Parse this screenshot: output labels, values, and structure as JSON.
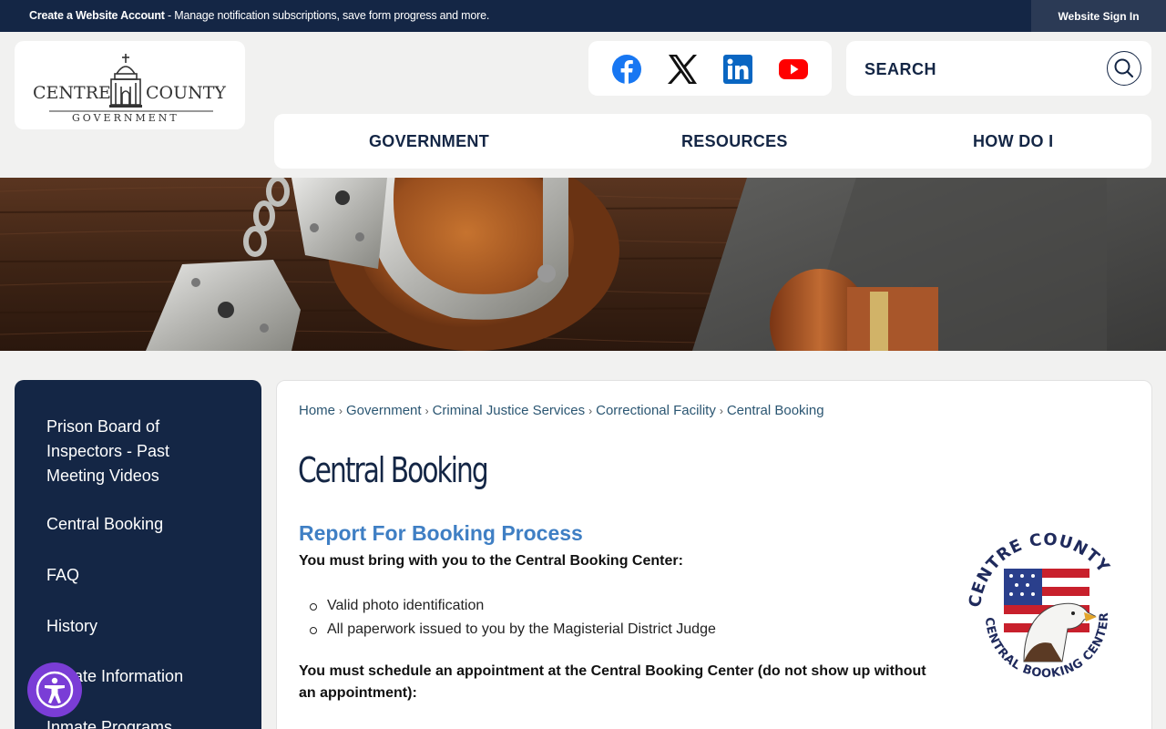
{
  "topbar": {
    "account_bold": "Create a Website Account",
    "account_rest": " - Manage notification subscriptions, save form progress and more.",
    "signin_label": "Website Sign In"
  },
  "logo": {
    "line1_left": "CENTRE",
    "line1_right": "COUNTY",
    "line2": "GOVERNMENT"
  },
  "social": [
    "facebook-icon",
    "x-icon",
    "linkedin-icon",
    "youtube-icon"
  ],
  "search": {
    "label": "SEARCH"
  },
  "nav": {
    "items": [
      "GOVERNMENT",
      "RESOURCES",
      "HOW DO I"
    ]
  },
  "sidebar": {
    "items": [
      "Prison Board of Inspectors - Past Meeting Videos",
      "Central Booking",
      "FAQ",
      "History",
      "Inmate Information",
      "Inmate Programs"
    ]
  },
  "breadcrumb": [
    "Home",
    "Government",
    "Criminal Justice Services",
    "Correctional Facility",
    "Central Booking"
  ],
  "page": {
    "title": "Central Booking",
    "subhead": "Report For Booking Process",
    "intro": "You must bring with you to the Central Booking Center:",
    "bullets": [
      "Valid photo identification",
      "All paperwork issued to you by the Magisterial District Judge"
    ],
    "schedule": "You must schedule an appointment at the Central Booking Center (do not show up without an appointment):"
  },
  "seal": {
    "top_text": "CENTRE COUNTY",
    "bottom_text": "CENTRAL BOOKING CENTER"
  },
  "colors": {
    "navy": "#142645",
    "accent_blue": "#3f7fc4",
    "accessibility_purple": "#7a3dd6"
  }
}
